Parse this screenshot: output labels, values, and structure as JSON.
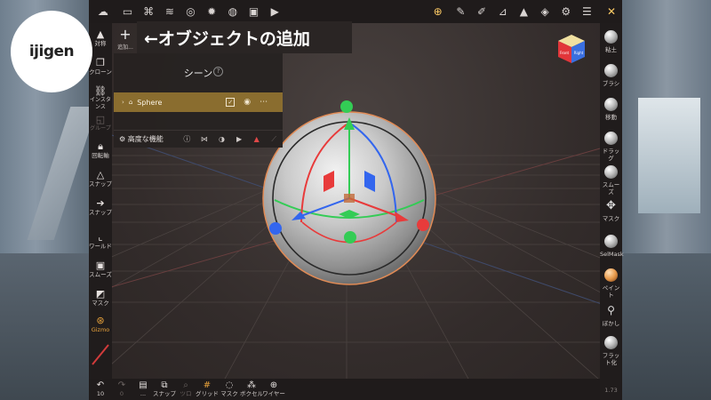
{
  "logo": {
    "text": "ijigen"
  },
  "caption": {
    "text": "←オブジェクトの追加"
  },
  "add_button": {
    "icon": "plus-icon",
    "label": "追加..."
  },
  "scene_panel": {
    "title": "シーン",
    "help": "?",
    "object": {
      "name": "Sphere",
      "icon": "mesh-icon"
    },
    "footer": {
      "advanced_label": "高度な機能"
    }
  },
  "top_toolbar": {
    "icons": [
      "cloud-icon",
      "folder-icon",
      "node-tree-icon",
      "layers-icon",
      "globe-icon",
      "sun-icon",
      "sphere-icon",
      "image-icon",
      "camera-icon",
      "gizmo-icon",
      "pen-icon",
      "eyedropper-icon",
      "ruler-icon",
      "triangle-icon",
      "stack-icon",
      "gear-icon",
      "sliders-icon",
      "tools-icon"
    ]
  },
  "left_toolbar": [
    {
      "icon": "symmetry-icon",
      "label": "対称"
    },
    {
      "icon": "clone-icon",
      "label": "クローン"
    },
    {
      "icon": "instance-icon",
      "label": "インスタンス"
    },
    {
      "icon": "group-icon",
      "label": "グループ"
    },
    {
      "icon": "lock-icon",
      "label": "回転軸"
    },
    {
      "icon": "snap-icon",
      "label": "スナップ"
    },
    {
      "icon": "arrow-icon",
      "label": "スナップ"
    },
    {
      "icon": "world-icon",
      "label": "ワールド"
    },
    {
      "icon": "smooth-icon",
      "label": "スムーズ"
    },
    {
      "icon": "mask-icon",
      "label": "マスク"
    },
    {
      "icon": "gizmo-icon",
      "label": "Gizmo"
    }
  ],
  "right_toolbar": [
    {
      "label": "粘土"
    },
    {
      "label": "ブラシ"
    },
    {
      "label": "移動"
    },
    {
      "label": "ドラッグ"
    },
    {
      "label": "スムーズ"
    },
    {
      "label": "マスク"
    },
    {
      "label": "SelMask"
    },
    {
      "label": "ペイント"
    },
    {
      "label": "ぼかし"
    },
    {
      "label": "フラット化"
    }
  ],
  "bottom_toolbar": [
    {
      "icon": "undo-icon",
      "label": "10"
    },
    {
      "icon": "redo-icon",
      "label": "0"
    },
    {
      "icon": "book-icon",
      "label": "..."
    },
    {
      "icon": "snapshot-icon",
      "label": "スナップ"
    },
    {
      "icon": "search-icon",
      "label": "ツロ"
    },
    {
      "icon": "grid-icon",
      "label": "グリッド"
    },
    {
      "icon": "mask-icon",
      "label": "マスク"
    },
    {
      "icon": "voxel-icon",
      "label": "ボクセル"
    },
    {
      "icon": "wire-icon",
      "label": "ワイヤー"
    }
  ],
  "view_cube": {
    "front": "Front",
    "right": "Right"
  },
  "status": {
    "version": "1.73"
  },
  "colors": {
    "panel_row": "#8a6d2f",
    "x_axis": "#e83b3b",
    "y_axis": "#33cc55",
    "z_axis": "#3366ee"
  }
}
